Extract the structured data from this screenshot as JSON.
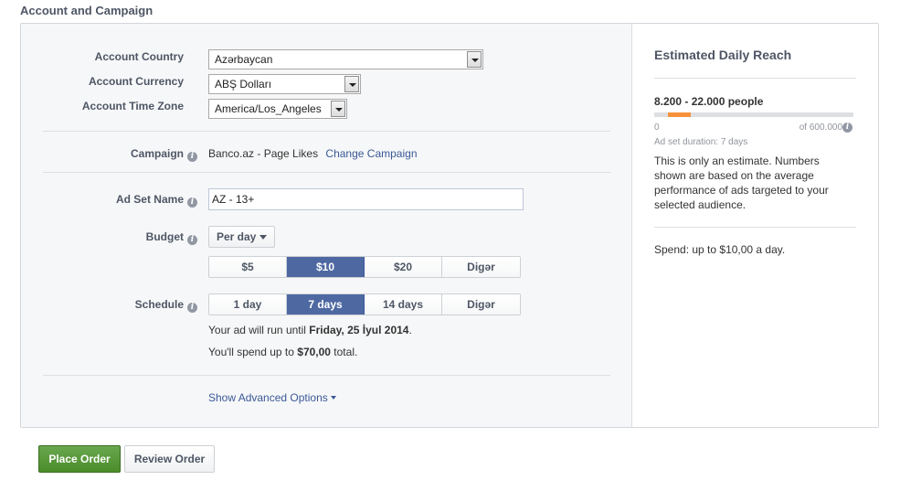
{
  "section_title": "Account and Campaign",
  "account": {
    "country_label": "Account Country",
    "country_value": "Azərbaycan",
    "currency_label": "Account Currency",
    "currency_value": "ABŞ Dolları",
    "timezone_label": "Account Time Zone",
    "timezone_value": "America/Los_Angeles"
  },
  "campaign": {
    "label": "Campaign",
    "value": "Banco.az - Page Likes",
    "change_link": "Change Campaign"
  },
  "ad_set": {
    "label": "Ad Set Name",
    "value": "AZ - 13+"
  },
  "budget": {
    "label": "Budget",
    "type_value": "Per day",
    "options": [
      "$5",
      "$10",
      "$20",
      "Digər"
    ],
    "selected_index": 1
  },
  "schedule": {
    "label": "Schedule",
    "options": [
      "1 day",
      "7 days",
      "14 days",
      "Digər"
    ],
    "selected_index": 1,
    "run_prefix": "Your ad will run until ",
    "run_date": "Friday, 25 İyul 2014",
    "run_suffix": ".",
    "spend_prefix": "You'll spend up to ",
    "spend_amount": "$70,00",
    "spend_suffix": " total."
  },
  "advanced_link": "Show Advanced Options",
  "reach": {
    "title": "Estimated Daily Reach",
    "range": "8.200 - 22.000 people",
    "gauge_min": "0",
    "gauge_max": "of 600.000",
    "gauge_start_fraction": 0.0137,
    "gauge_end_fraction": 0.0367,
    "duration": "Ad set duration: 7 days",
    "note": "This is only an estimate. Numbers shown are based on the average performance of ads targeted to your selected audience.",
    "spend": "Spend: up to $10,00 a day."
  },
  "buttons": {
    "place_order": "Place Order",
    "review_order": "Review Order"
  },
  "colors": {
    "accent": "#4e69a2",
    "link": "#3b5998",
    "primary_button": "#4a8c2a",
    "gauge": "#f7923b"
  }
}
